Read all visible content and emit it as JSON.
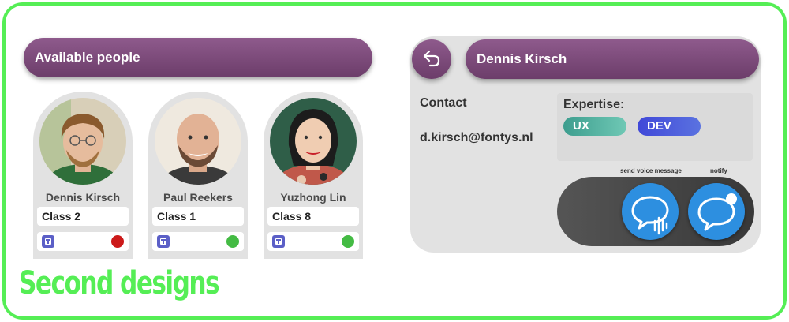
{
  "available_people": {
    "title": "Available people",
    "people": [
      {
        "name": "Dennis Kirsch",
        "class": "Class 2",
        "status_color": "#cc1a1a"
      },
      {
        "name": "Paul Reekers",
        "class": "Class 1",
        "status_color": "#44bb44"
      },
      {
        "name": "Yuzhong Lin",
        "class": "Class 8",
        "status_color": "#44bb44"
      }
    ]
  },
  "profile": {
    "name": "Dennis Kirsch",
    "contact_label": "Contact",
    "email": "d.kirsch@fontys.nl",
    "expertise_label": "Expertise:",
    "tags": [
      "UX",
      "DEV"
    ],
    "actions": {
      "voice_label": "send voice message",
      "notify_label": "notify"
    }
  },
  "section_title": "Second designs",
  "colors": {
    "accent_purple": "#7a4a78",
    "green_border": "#55ee55",
    "action_blue": "#2d8fe0"
  },
  "icons": [
    "back-arrow-icon",
    "teams-icon",
    "voice-message-icon",
    "notify-icon"
  ]
}
